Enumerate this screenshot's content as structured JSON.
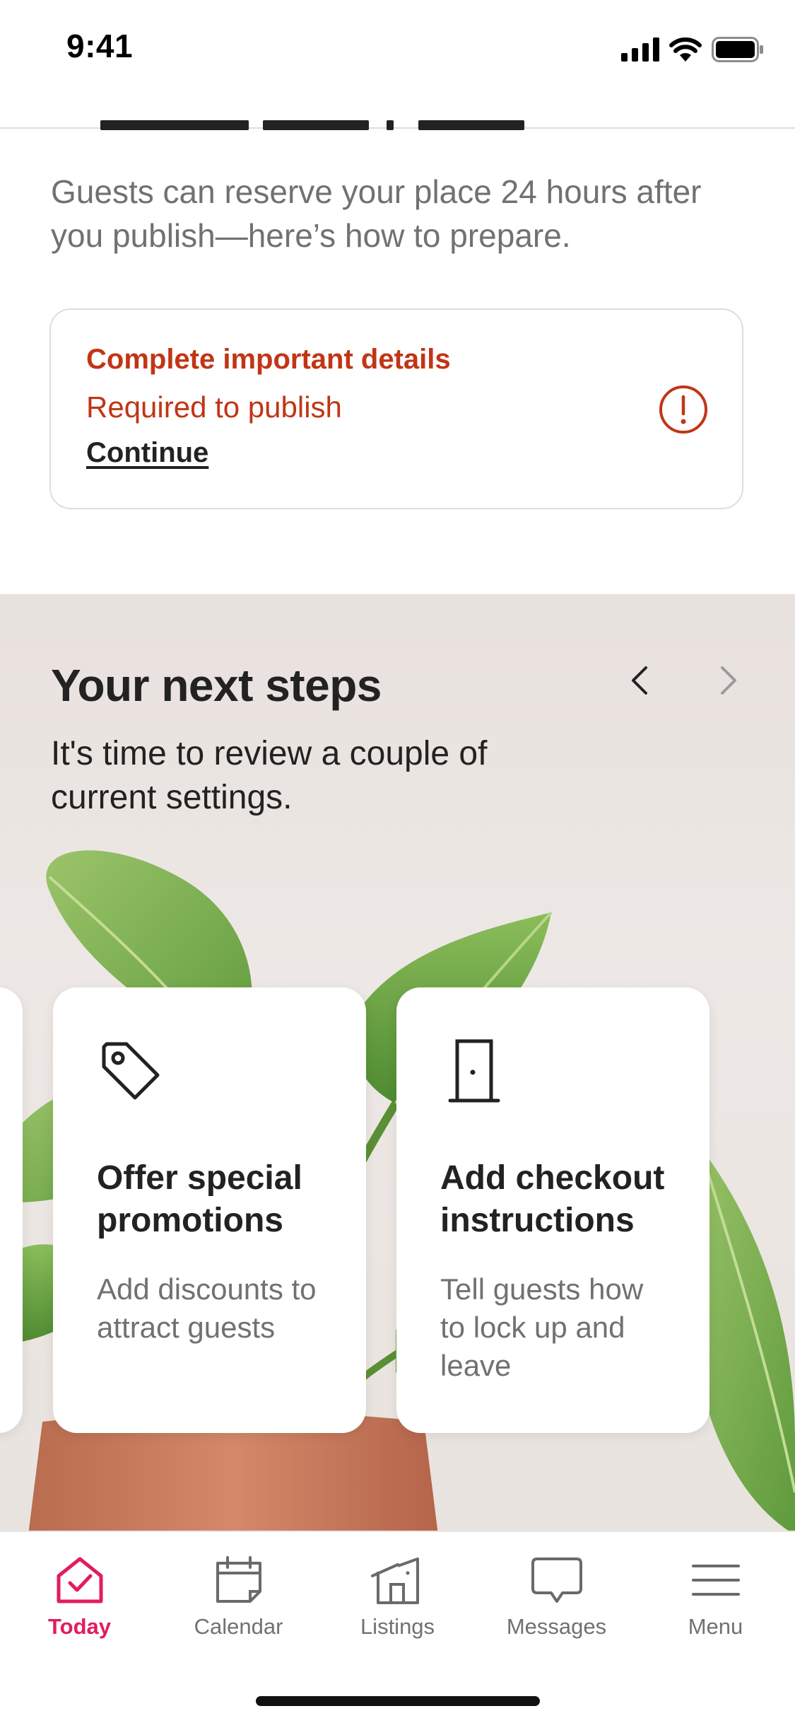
{
  "status_bar": {
    "time": "9:41"
  },
  "intro": {
    "text": "Guests can reserve your place 24 hours after you publish—here’s how to prepare."
  },
  "alert": {
    "title": "Complete important details",
    "subtitle": "Required to publish",
    "link": "Continue",
    "icon": "alert-circle-icon",
    "color": "#C13515"
  },
  "next_steps": {
    "title": "Your next steps",
    "subtitle": "It's time to review a couple of current settings.",
    "cards": [
      {
        "icon": "tag-icon",
        "title": "Offer special promotions",
        "description": "Add discounts to attract guests"
      },
      {
        "icon": "door-icon",
        "title": "Add checkout instructions",
        "description": "Tell guests how to lock up and leave"
      }
    ]
  },
  "tabbar": {
    "active_color": "#E31C5F",
    "tabs": [
      {
        "label": "Today",
        "icon": "home-check-icon",
        "active": true
      },
      {
        "label": "Calendar",
        "icon": "calendar-icon",
        "active": false
      },
      {
        "label": "Listings",
        "icon": "building-icon",
        "active": false
      },
      {
        "label": "Messages",
        "icon": "message-icon",
        "active": false
      },
      {
        "label": "Menu",
        "icon": "menu-icon",
        "active": false
      }
    ]
  }
}
